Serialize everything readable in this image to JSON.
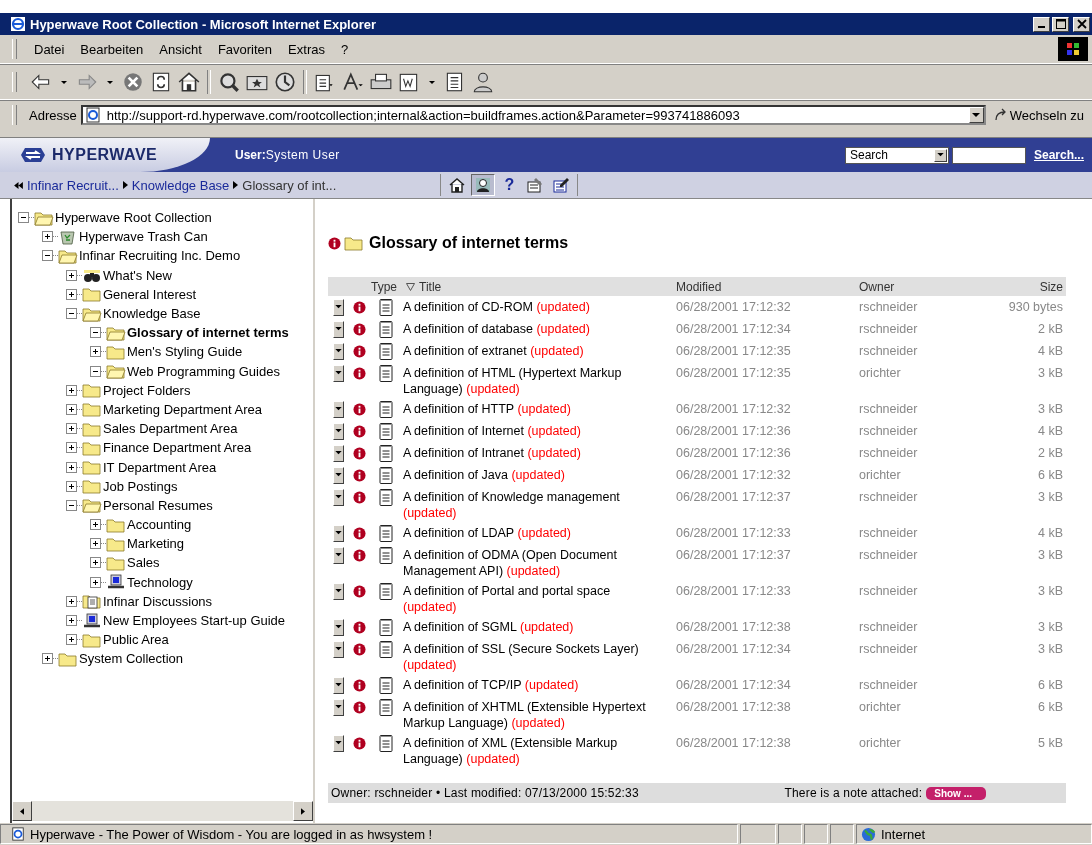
{
  "window": {
    "title": "Hyperwave Root Collection - Microsoft Internet Explorer"
  },
  "menu": [
    "Datei",
    "Bearbeiten",
    "Ansicht",
    "Favoriten",
    "Extras",
    "?"
  ],
  "address": {
    "label": "Adresse",
    "value": "http://support-rd.hyperwave.com/rootcollection;internal&action=buildframes.action&Parameter=993741886093",
    "go": "Wechseln zu"
  },
  "header": {
    "logo": "HYPERWAVE",
    "user_label": "User:",
    "user_name": "System User",
    "search_scope": "Search",
    "search_link": "Search..."
  },
  "breadcrumb": {
    "items": [
      "Infinar Recruit...",
      "Knowledge Base",
      "Glossary of int..."
    ],
    "tools": [
      {
        "kind": "home",
        "selected": false
      },
      {
        "kind": "user",
        "selected": true
      },
      {
        "kind": "help",
        "label": "?",
        "selected": false
      },
      {
        "kind": "properties",
        "selected": false
      },
      {
        "kind": "edit",
        "selected": false
      }
    ]
  },
  "tree": [
    {
      "label": "Hyperwave Root Collection",
      "kind": "folder",
      "expanded": true,
      "selected": false,
      "children": [
        {
          "label": "Hyperwave Trash Can",
          "kind": "trash",
          "expanded": false,
          "selected": false
        },
        {
          "label": "Infinar Recruiting Inc. Demo",
          "kind": "folder",
          "expanded": true,
          "selected": false,
          "children": [
            {
              "label": "What's New",
              "kind": "binoculars",
              "expanded": false,
              "selected": false
            },
            {
              "label": "General Interest",
              "kind": "folder",
              "expanded": false,
              "selected": false
            },
            {
              "label": "Knowledge Base",
              "kind": "folder",
              "expanded": true,
              "selected": false,
              "children": [
                {
                  "label": "Glossary of internet terms",
                  "kind": "folder",
                  "expanded": true,
                  "selected": true
                },
                {
                  "label": "Men's Styling Guide",
                  "kind": "folder",
                  "expanded": false,
                  "selected": false
                },
                {
                  "label": "Web Programming Guides",
                  "kind": "folder",
                  "expanded": true,
                  "selected": false
                }
              ]
            },
            {
              "label": "Project Folders",
              "kind": "folder",
              "expanded": false,
              "selected": false
            },
            {
              "label": "Marketing Department Area",
              "kind": "folder",
              "expanded": false,
              "selected": false
            },
            {
              "label": "Sales Department Area",
              "kind": "folder",
              "expanded": false,
              "selected": false
            },
            {
              "label": "Finance Department Area",
              "kind": "folder",
              "expanded": false,
              "selected": false
            },
            {
              "label": "IT Department Area",
              "kind": "folder",
              "expanded": false,
              "selected": false
            },
            {
              "label": "Job Postings",
              "kind": "folder",
              "expanded": false,
              "selected": false
            },
            {
              "label": "Personal Resumes",
              "kind": "folder",
              "expanded": true,
              "selected": false,
              "children": [
                {
                  "label": "Accounting",
                  "kind": "folder",
                  "expanded": false,
                  "selected": false
                },
                {
                  "label": "Marketing",
                  "kind": "folder",
                  "expanded": false,
                  "selected": false
                },
                {
                  "label": "Sales",
                  "kind": "folder",
                  "expanded": false,
                  "selected": false
                },
                {
                  "label": "Technology",
                  "kind": "guide",
                  "expanded": false,
                  "selected": false
                }
              ]
            },
            {
              "label": "Infinar Discussions",
              "kind": "discussion",
              "expanded": false,
              "selected": false
            },
            {
              "label": "New Employees Start-up Guide",
              "kind": "guide",
              "expanded": false,
              "selected": false
            },
            {
              "label": "Public Area",
              "kind": "folder",
              "expanded": false,
              "selected": false
            }
          ]
        },
        {
          "label": "System Collection",
          "kind": "folder",
          "expanded": false,
          "selected": false
        }
      ]
    }
  ],
  "content": {
    "title": "Glossary of internet terms",
    "columns": [
      "Type",
      "Title",
      "Modified",
      "Owner",
      "Size"
    ],
    "rows": [
      {
        "title": "A definition of CD-ROM",
        "status": "(updated)",
        "modified": "06/28/2001 17:12:32",
        "owner": "rschneider",
        "size": "930 bytes"
      },
      {
        "title": "A definition of database",
        "status": "(updated)",
        "modified": "06/28/2001 17:12:34",
        "owner": "rschneider",
        "size": "2 kB"
      },
      {
        "title": "A definition of extranet",
        "status": "(updated)",
        "modified": "06/28/2001 17:12:35",
        "owner": "rschneider",
        "size": "4 kB"
      },
      {
        "title": "A definition of HTML (Hypertext Markup Language)",
        "status": "(updated)",
        "modified": "06/28/2001 17:12:35",
        "owner": "orichter",
        "size": "3 kB"
      },
      {
        "title": "A definition of HTTP",
        "status": "(updated)",
        "modified": "06/28/2001 17:12:32",
        "owner": "rschneider",
        "size": "3 kB"
      },
      {
        "title": "A definition of Internet",
        "status": "(updated)",
        "modified": "06/28/2001 17:12:36",
        "owner": "rschneider",
        "size": "4 kB"
      },
      {
        "title": "A definition of Intranet",
        "status": "(updated)",
        "modified": "06/28/2001 17:12:36",
        "owner": "rschneider",
        "size": "2 kB"
      },
      {
        "title": "A definition of Java",
        "status": "(updated)",
        "modified": "06/28/2001 17:12:32",
        "owner": "orichter",
        "size": "6 kB"
      },
      {
        "title": "A definition of Knowledge management",
        "status": "(updated)",
        "modified": "06/28/2001 17:12:37",
        "owner": "rschneider",
        "size": "3 kB"
      },
      {
        "title": "A definition of LDAP",
        "status": "(updated)",
        "modified": "06/28/2001 17:12:33",
        "owner": "rschneider",
        "size": "4 kB"
      },
      {
        "title": "A definition of ODMA (Open Document Management API)",
        "status": "(updated)",
        "modified": "06/28/2001 17:12:37",
        "owner": "rschneider",
        "size": "3 kB"
      },
      {
        "title": "A definition of Portal and portal space",
        "status": "(updated)",
        "modified": "06/28/2001 17:12:33",
        "owner": "rschneider",
        "size": "3 kB"
      },
      {
        "title": "A definition of SGML",
        "status": "(updated)",
        "modified": "06/28/2001 17:12:38",
        "owner": "rschneider",
        "size": "3 kB"
      },
      {
        "title": "A definition of SSL (Secure Sockets Layer)",
        "status": "(updated)",
        "modified": "06/28/2001 17:12:34",
        "owner": "rschneider",
        "size": "3 kB"
      },
      {
        "title": "A definition of TCP/IP",
        "status": "(updated)",
        "modified": "06/28/2001 17:12:34",
        "owner": "rschneider",
        "size": "6 kB"
      },
      {
        "title": "A definition of XHTML (Extensible Hypertext Markup Language)",
        "status": "(updated)",
        "modified": "06/28/2001 17:12:38",
        "owner": "orichter",
        "size": "6 kB"
      },
      {
        "title": "A definition of XML (Extensible Markup Language)",
        "status": "(updated)",
        "modified": "06/28/2001 17:12:38",
        "owner": "orichter",
        "size": "5 kB"
      }
    ],
    "footer": {
      "info": "Owner: rschneider • Last modified: 07/13/2000 15:52:33",
      "note_label": "There is a note attached:",
      "note_button": "Show ..."
    }
  },
  "status_bar": {
    "text": "Hyperwave - The Power of Wisdom - You are logged in as hwsystem !",
    "zone": "Internet"
  }
}
